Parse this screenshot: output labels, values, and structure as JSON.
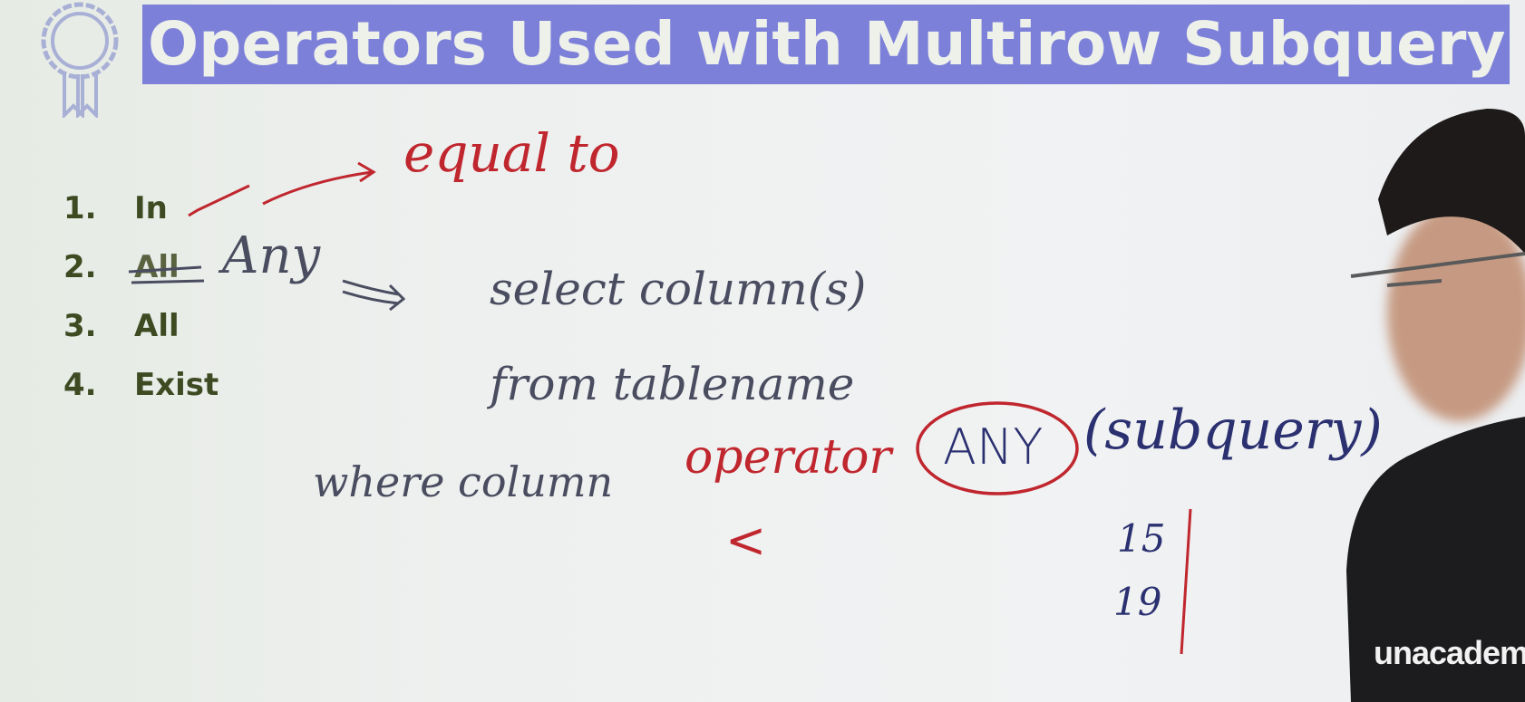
{
  "slide": {
    "title": "Operators Used with Multirow Subquery",
    "list": [
      {
        "num": "1.",
        "label": "In"
      },
      {
        "num": "2.",
        "label": "All"
      },
      {
        "num": "3.",
        "label": "All"
      },
      {
        "num": "4.",
        "label": "Exist"
      }
    ]
  },
  "annotations": {
    "equal_to": "equal to",
    "any": "Any",
    "select_line": "select column(s)",
    "from_line": "from tablename",
    "where_line": "where column",
    "operator": "operator",
    "any_circled": "ANY",
    "subquery": "(subquery)",
    "less_than": "<",
    "values": [
      "15",
      "19"
    ]
  },
  "presenter": {
    "shirt_brand": "unacademy"
  },
  "colors": {
    "title_band": "#7c80d8",
    "list_text": "#3e4a22",
    "ink_red": "#c0262e",
    "ink_blue": "#2a3070"
  }
}
